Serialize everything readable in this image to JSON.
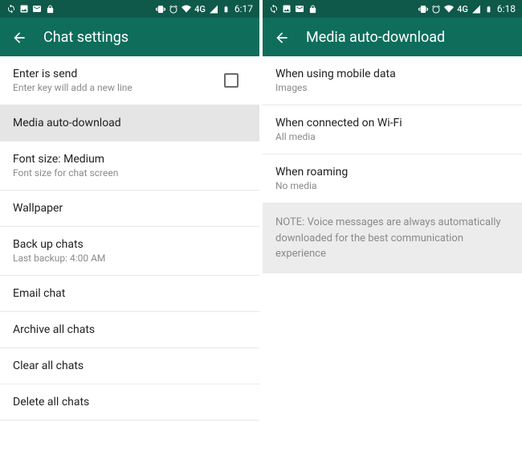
{
  "left": {
    "status": {
      "time": "6:17",
      "network": "4G"
    },
    "appbar": {
      "title": "Chat settings"
    },
    "items": [
      {
        "title": "Enter is send",
        "subtitle": "Enter key will add a new line",
        "checkbox": true
      },
      {
        "title": "Media auto-download",
        "subtitle": "",
        "highlighted": true
      },
      {
        "title": "Font size: Medium",
        "subtitle": "Font size for chat screen"
      },
      {
        "title": "Wallpaper",
        "subtitle": ""
      },
      {
        "title": "Back up chats",
        "subtitle": "Last backup: 4:00 AM"
      },
      {
        "title": "Email chat",
        "subtitle": ""
      },
      {
        "title": "Archive all chats",
        "subtitle": ""
      },
      {
        "title": "Clear all chats",
        "subtitle": ""
      },
      {
        "title": "Delete all chats",
        "subtitle": ""
      }
    ]
  },
  "right": {
    "status": {
      "time": "6:18",
      "network": "4G"
    },
    "appbar": {
      "title": "Media auto-download"
    },
    "items": [
      {
        "title": "When using mobile data",
        "subtitle": "Images"
      },
      {
        "title": "When connected on Wi-Fi",
        "subtitle": "All media"
      },
      {
        "title": "When roaming",
        "subtitle": "No media"
      }
    ],
    "note": "NOTE: Voice messages are always automatically downloaded for the best communication experience"
  }
}
